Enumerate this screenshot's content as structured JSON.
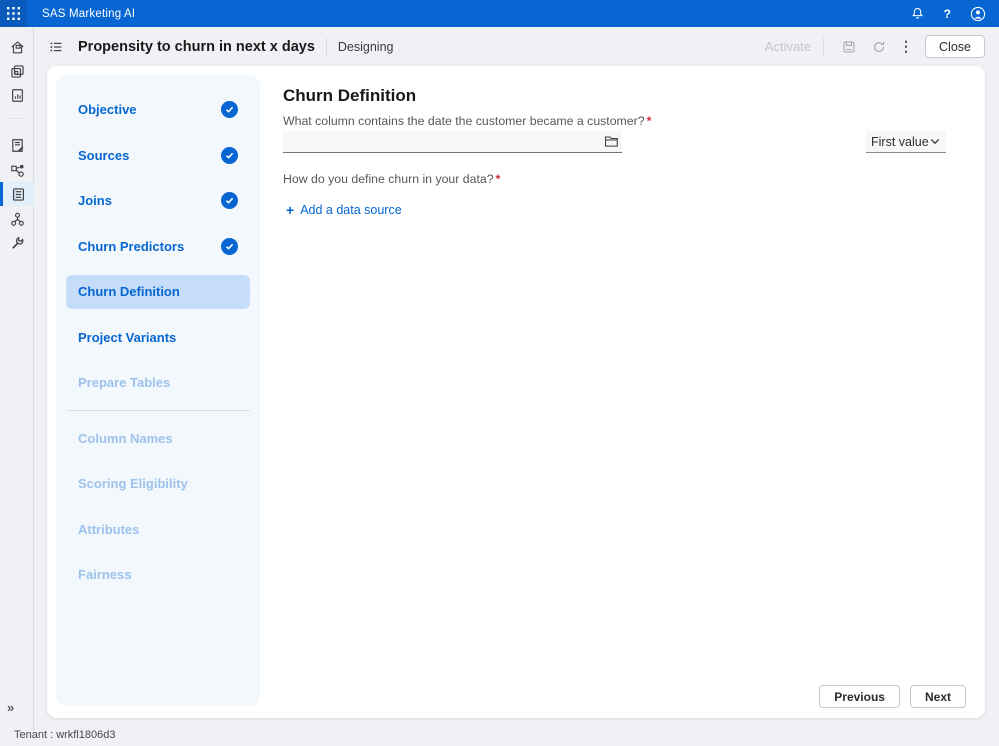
{
  "topbar": {
    "app_title": "SAS Marketing AI"
  },
  "header": {
    "project_title": "Propensity to churn in next x days",
    "status": "Designing",
    "activate_label": "Activate",
    "close_label": "Close"
  },
  "sidebar": {
    "steps": [
      {
        "label": "Objective",
        "state": "completed"
      },
      {
        "label": "Sources",
        "state": "completed"
      },
      {
        "label": "Joins",
        "state": "completed"
      },
      {
        "label": "Churn Predictors",
        "state": "completed"
      },
      {
        "label": "Churn Definition",
        "state": "active"
      },
      {
        "label": "Project Variants",
        "state": "enabled"
      },
      {
        "label": "Prepare Tables",
        "state": "disabled"
      },
      {
        "label": "Column Names",
        "state": "disabled"
      },
      {
        "label": "Scoring Eligibility",
        "state": "disabled"
      },
      {
        "label": "Attributes",
        "state": "disabled"
      },
      {
        "label": "Fairness",
        "state": "disabled"
      }
    ]
  },
  "main": {
    "heading": "Churn Definition",
    "question1": "What column contains the date the customer became a customer?",
    "required_marker": "*",
    "column_input_value": "",
    "value_dropdown_selected": "First value",
    "question2": "How do you define churn in your data?",
    "add_data_source_label": "Add a data source",
    "previous_label": "Previous",
    "next_label": "Next"
  },
  "footer": {
    "tenant_label": "Tenant : wrkfl1806d3"
  },
  "icons": {
    "expand_rail": "»",
    "kebab": "⋮",
    "help": "?",
    "add_plus": "+"
  },
  "colors": {
    "brand_blue": "#0766d1",
    "topbar_apps_tile": "#0a5abc",
    "selected_step_bg": "#c5ddf8",
    "disabled_step_text": "#9dc2ec",
    "required_red": "#cf2e2e",
    "page_background": "#eff1f4"
  }
}
